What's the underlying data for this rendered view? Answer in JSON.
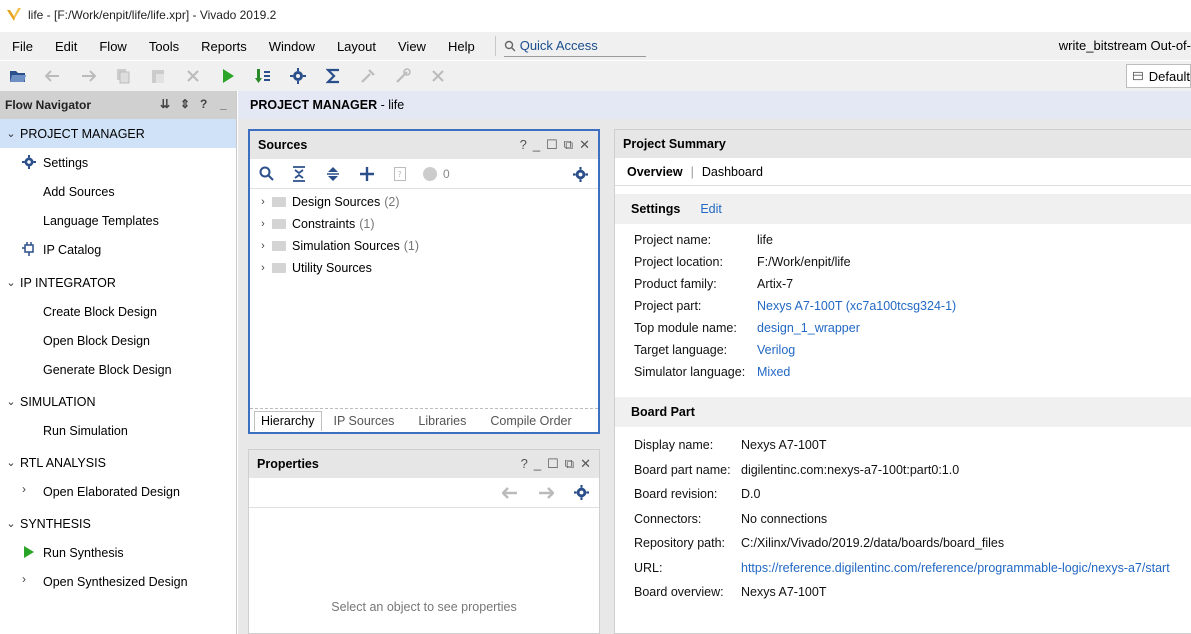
{
  "window": {
    "title": "life - [F:/Work/enpit/life/life.xpr] - Vivado 2019.2"
  },
  "menu": {
    "items": [
      "File",
      "Edit",
      "Flow",
      "Tools",
      "Reports",
      "Window",
      "Layout",
      "View",
      "Help"
    ],
    "quick_access": "Quick Access",
    "status": "write_bitstream Out-of-"
  },
  "toolbar": {
    "icons": [
      "open-project-icon",
      "undo-icon",
      "redo-icon",
      "copy-icon",
      "paste-icon",
      "delete-icon",
      "run-icon",
      "program-icon",
      "settings-icon",
      "sigma-icon",
      "tool-icon",
      "tool2-icon",
      "cancel-icon"
    ],
    "layout": "Default"
  },
  "flow_nav": {
    "title": "Flow Navigator",
    "sections": [
      {
        "label": "PROJECT MANAGER",
        "items": [
          "Settings",
          "Add Sources",
          "Language Templates",
          "IP Catalog"
        ]
      },
      {
        "label": "IP INTEGRATOR",
        "items": [
          "Create Block Design",
          "Open Block Design",
          "Generate Block Design"
        ]
      },
      {
        "label": "SIMULATION",
        "items": [
          "Run Simulation"
        ]
      },
      {
        "label": "RTL ANALYSIS",
        "items": [
          "Open Elaborated Design"
        ]
      },
      {
        "label": "SYNTHESIS",
        "items": [
          "Run Synthesis",
          "Open Synthesized Design"
        ]
      }
    ]
  },
  "main": {
    "header_bold": "PROJECT MANAGER",
    "header_rest": " - life"
  },
  "sources": {
    "title": "Sources",
    "badge": "0",
    "tree": [
      {
        "label": "Design Sources",
        "count": "(2)"
      },
      {
        "label": "Constraints",
        "count": "(1)"
      },
      {
        "label": "Simulation Sources",
        "count": "(1)"
      },
      {
        "label": "Utility Sources",
        "count": ""
      }
    ],
    "tabs": [
      "Hierarchy",
      "IP Sources",
      "Libraries",
      "Compile Order"
    ]
  },
  "properties": {
    "title": "Properties",
    "empty": "Select an object to see properties"
  },
  "summary": {
    "title": "Project Summary",
    "tab_overview": "Overview",
    "tab_sep": "|",
    "tab_dashboard": "Dashboard",
    "settings_title": "Settings",
    "edit": "Edit",
    "settings": [
      {
        "k": "Project name:",
        "v": "life",
        "link": false
      },
      {
        "k": "Project location:",
        "v": "F:/Work/enpit/life",
        "link": false
      },
      {
        "k": "Product family:",
        "v": "Artix-7",
        "link": false
      },
      {
        "k": "Project part:",
        "v": "Nexys A7-100T (xc7a100tcsg324-1)",
        "link": true
      },
      {
        "k": "Top module name:",
        "v": "design_1_wrapper",
        "link": true
      },
      {
        "k": "Target language:",
        "v": "Verilog",
        "link": true
      },
      {
        "k": "Simulator language:",
        "v": "Mixed",
        "link": true
      }
    ],
    "board_title": "Board Part",
    "board": [
      {
        "k": "Display name:",
        "v": "Nexys A7-100T",
        "link": false
      },
      {
        "k": "Board part name:",
        "v": "digilentinc.com:nexys-a7-100t:part0:1.0",
        "link": false
      },
      {
        "k": "Board revision:",
        "v": "D.0",
        "link": false
      },
      {
        "k": "Connectors:",
        "v": "No connections",
        "link": false
      },
      {
        "k": "Repository path:",
        "v": "C:/Xilinx/Vivado/2019.2/data/boards/board_files",
        "link": false
      },
      {
        "k": "URL:",
        "v": "https://reference.digilentinc.com/reference/programmable-logic/nexys-a7/start",
        "link": true
      },
      {
        "k": "Board overview:",
        "v": "Nexys A7-100T",
        "link": false
      }
    ]
  },
  "colors": {
    "accent": "#2268c4",
    "selected": "#cfe2f8",
    "run_green": "#2aa52a"
  }
}
